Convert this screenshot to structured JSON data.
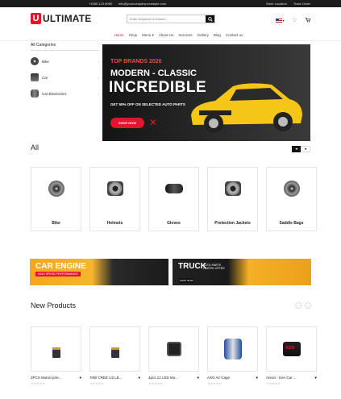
{
  "topbar": {
    "phone": "+1555 123 8069",
    "email": "info@yourcompany.example.com",
    "store": "Store Location",
    "track": "Track Order"
  },
  "header": {
    "logo_letter": "U",
    "logo_text": "ULTIMATE",
    "search_placeholder": "Enter Keyword to Search...",
    "lang": "▾"
  },
  "nav": [
    "Home",
    "Shop",
    "Menu ▾",
    "About Us",
    "Services",
    "Gallery",
    "Blog",
    "Contact us"
  ],
  "categories": {
    "title": "All Categories",
    "items": [
      "Bike",
      "Car",
      "Car Electronics"
    ]
  },
  "banner": {
    "tag": "TOP BRANDS 2020",
    "line1": "MODERN - CLASSIC",
    "line2": "INCREDIBLE",
    "line3": "GET 50% OFF ON SELECTED AUTO PARTS",
    "button": "SHOP NOW"
  },
  "all_section": {
    "title": "All",
    "items": [
      "Bike",
      "Helmets",
      "Gloves",
      "Protection Jackets",
      "Saddle Bags"
    ]
  },
  "promos": [
    {
      "big": "CAR ENGINE",
      "sub": "HIGH SPEED PERFORMANCE"
    },
    {
      "big": "TRUCK",
      "small1": "AUTO PARTS",
      "small2": "LIMITED OFFER",
      "button": "SHOP NOW"
    }
  ],
  "new_products": {
    "title": "New Products",
    "items": [
      {
        "name": "2PCS Motorcycle..."
      },
      {
        "name": "70W CREE U2 LE..."
      },
      {
        "name": "4pcs 12 LED Mo..."
      },
      {
        "name": "AXO Air Cage"
      },
      {
        "name": "Areon - Ken Car ..."
      }
    ]
  },
  "colors": {
    "accent": "#e4142c",
    "dark": "#1c1c1c",
    "promo_yellow": "#f4a81b"
  }
}
